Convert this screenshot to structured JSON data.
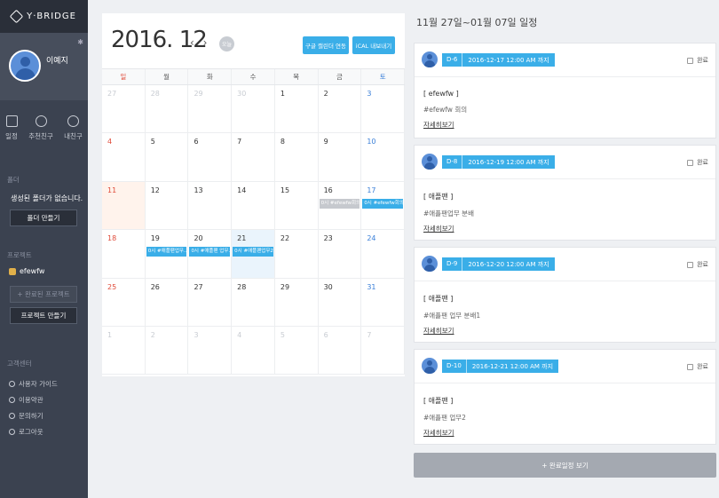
{
  "sidebar": {
    "logo": "Y·BRIDGE",
    "profile_name": "이예지",
    "nav": [
      {
        "label": "일정",
        "icon": "calendar-icon"
      },
      {
        "label": "추천친구",
        "icon": "target-icon"
      },
      {
        "label": "내친구",
        "icon": "user-icon"
      }
    ],
    "folder_title": "폴더",
    "folder_empty": "생성된 폴더가 없습니다.",
    "folder_btn": "폴더 만들기",
    "project_title": "프로젝트",
    "project_item": "efewfw",
    "completed_projects_btn": "+ 완료된 프로젝트",
    "make_project_btn": "프로젝트 만들기",
    "support_title": "고객센터",
    "support_items": [
      "사용자 가이드",
      "이용약관",
      "문의하기",
      "로그아웃"
    ]
  },
  "calendar": {
    "title": "2016. 12",
    "prev": "‹",
    "next": "›",
    "today_label": "오늘",
    "google_btn": "구글 캘린더 연동",
    "ical_btn": "iCAL 내보내기",
    "dow": [
      "일",
      "월",
      "화",
      "수",
      "목",
      "금",
      "토"
    ],
    "weeks": [
      [
        "27",
        "28",
        "29",
        "30",
        "1",
        "2",
        "3"
      ],
      [
        "4",
        "5",
        "6",
        "7",
        "8",
        "9",
        "10"
      ],
      [
        "11",
        "12",
        "13",
        "14",
        "15",
        "16",
        "17"
      ],
      [
        "18",
        "19",
        "20",
        "21",
        "22",
        "23",
        "24"
      ],
      [
        "25",
        "26",
        "27",
        "28",
        "29",
        "30",
        "31"
      ],
      [
        "1",
        "2",
        "3",
        "4",
        "5",
        "6",
        "7"
      ]
    ],
    "events": {
      "w2d5": "0시 #efewfw회의",
      "w2d6": "0시 #efewfw회의",
      "w3d1": "0시 #애플팬업무...",
      "w3d2": "0시 #애플팬 업무...",
      "w3d3": "0시 #애플팬업무2"
    }
  },
  "panel": {
    "title": "11월 27일~01월 07일 일정",
    "done_label": "완료",
    "detail_label": "자세히보기",
    "cards": [
      {
        "dday": "D-6",
        "date": "2016-12-17 12:00 AM 까지",
        "title": "[ efewfw ]",
        "desc": "#efewfw 회의"
      },
      {
        "dday": "D-8",
        "date": "2016-12-19 12:00 AM 까지",
        "title": "[ 애플팬 ]",
        "desc": "#애플팬업무 분배"
      },
      {
        "dday": "D-9",
        "date": "2016-12-20 12:00 AM 까지",
        "title": "[ 애플팬 ]",
        "desc": "#애플팬 업무 분배1"
      },
      {
        "dday": "D-10",
        "date": "2016-12-21 12:00 AM 까지",
        "title": "[ 애플팬 ]",
        "desc": "#애플팬 업무2"
      }
    ],
    "completed_btn": "+ 완료일정 보기"
  }
}
